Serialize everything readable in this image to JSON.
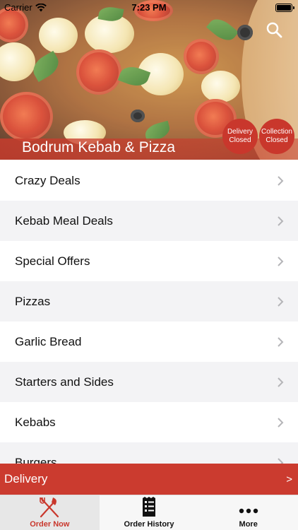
{
  "status_bar": {
    "carrier": "Carrier",
    "time": "7:23 PM"
  },
  "header": {
    "restaurant_name": "Bodrum Kebab & Pizza",
    "search_icon": "search-icon",
    "badges": {
      "delivery": {
        "line1": "Delivery",
        "line2": "Closed"
      },
      "collection": {
        "line1": "Collection",
        "line2": "Closed"
      }
    }
  },
  "menu": {
    "items": [
      {
        "label": "Crazy Deals"
      },
      {
        "label": "Kebab Meal Deals"
      },
      {
        "label": "Special Offers"
      },
      {
        "label": "Pizzas"
      },
      {
        "label": "Garlic Bread"
      },
      {
        "label": "Starters and Sides"
      },
      {
        "label": "Kebabs"
      },
      {
        "label": "Burgers"
      }
    ]
  },
  "delivery_bar": {
    "label": "Delivery",
    "arrow": ">"
  },
  "tabbar": {
    "tabs": [
      {
        "label": "Order Now",
        "icon": "fork-knife-icon",
        "active": true
      },
      {
        "label": "Order History",
        "icon": "receipt-icon",
        "active": false
      },
      {
        "label": "More",
        "icon": "more-dots-icon",
        "active": false
      }
    ]
  },
  "colors": {
    "accent": "#cb3b2f",
    "badge": "#c9372c",
    "row_alt": "#f3f3f5",
    "tabbar_bg": "#f7f7f7"
  }
}
